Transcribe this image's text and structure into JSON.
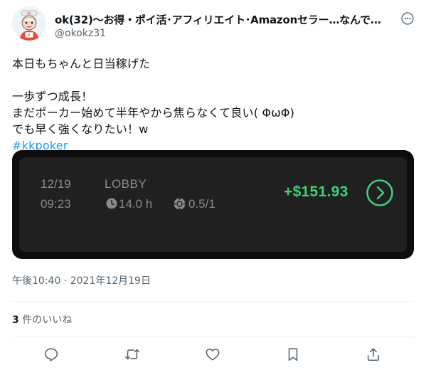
{
  "user": {
    "display_name": "ok(32)〜お得・ポイ活･アフィリエイト･Amazonセラー…なんでも…",
    "handle": "@okokz31"
  },
  "tweet": {
    "lines": [
      "本日もちゃんと日当稼げた",
      "",
      "一歩ずつ成長！",
      "まだポーカー始めて半年やから焦らなくて良い( ΦωΦ)",
      "でも早く強くなりたい！w"
    ],
    "hashtag": "#kkpoker"
  },
  "media": {
    "date": "12/19",
    "time": "09:23",
    "lobby": "LOBBY",
    "hours": "14.0 h",
    "stakes": "0.5/1",
    "amount": "+$151.93",
    "accent_color": "#3fcf77"
  },
  "timestamp": "午後10:40 · 2021年12月19日",
  "likes": {
    "count": "3",
    "label": " 件のいいね"
  },
  "actions": [
    "reply-icon",
    "retweet-icon",
    "like-icon",
    "bookmark-icon",
    "share-icon"
  ]
}
